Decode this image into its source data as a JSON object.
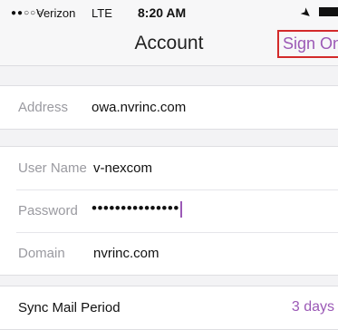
{
  "status_bar": {
    "signal": "●●○○○",
    "carrier": "Verizon",
    "network": "LTE",
    "time": "8:20 AM",
    "location_icon": "location-arrow-icon",
    "battery_icon": "battery-icon"
  },
  "nav": {
    "title": "Account",
    "sign_on_label": "Sign On"
  },
  "server": {
    "address_label": "Address",
    "address_value": "owa.nvrinc.com"
  },
  "credentials": {
    "username_label": "User Name",
    "username_value": "v-nexcom",
    "password_label": "Password",
    "password_value": "•••••••••••••••",
    "domain_label": "Domain",
    "domain_value": "nvrinc.com"
  },
  "sync": {
    "label": "Sync Mail Period",
    "value": "3 days"
  },
  "colors": {
    "accent": "#9b59b6",
    "highlight_border": "#d32a2a",
    "label_gray": "#9a9aa0",
    "group_background": "#f3f3f5"
  }
}
